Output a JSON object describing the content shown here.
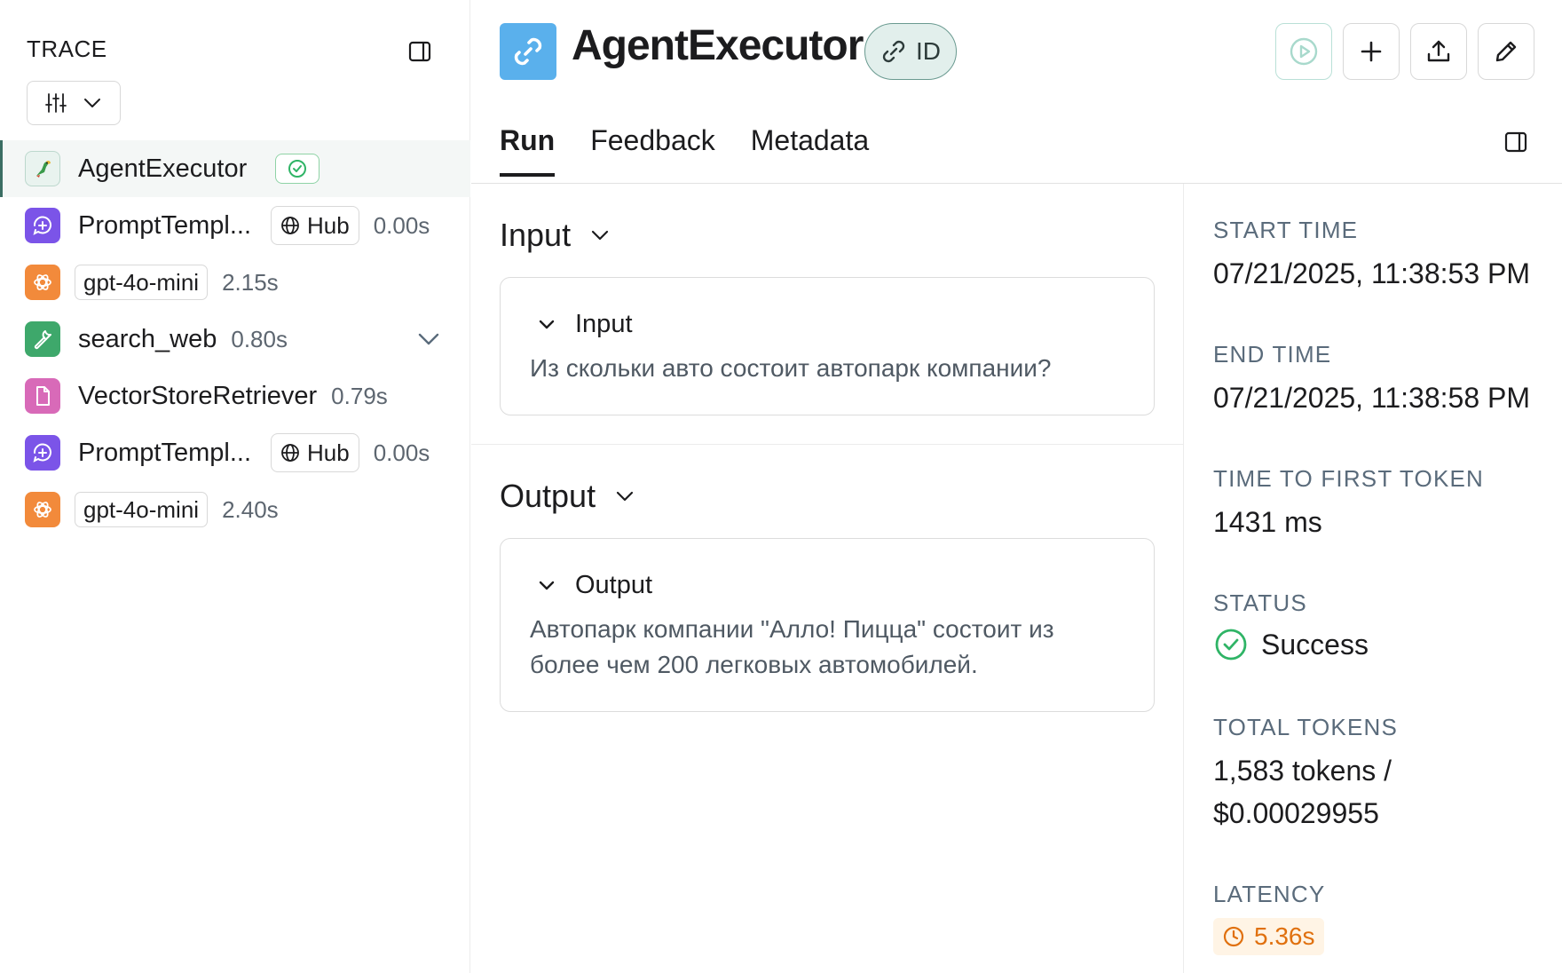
{
  "trace": {
    "header": "TRACE",
    "runs": [
      {
        "name": "AgentExecutor",
        "icon": "parrot-icon"
      },
      {
        "name": "PromptTempl...",
        "icon": "prompt-icon",
        "hub": "Hub",
        "duration": "0.00s"
      },
      {
        "model": "gpt-4o-mini",
        "icon": "openai-icon",
        "duration": "2.15s"
      },
      {
        "name": "search_web",
        "icon": "wrench-icon",
        "duration": "0.80s"
      },
      {
        "name": "VectorStoreRetriever",
        "icon": "document-icon",
        "duration": "0.79s"
      },
      {
        "name": "PromptTempl...",
        "icon": "prompt-icon",
        "hub": "Hub",
        "duration": "0.00s"
      },
      {
        "model": "gpt-4o-mini",
        "icon": "openai-icon",
        "duration": "2.40s"
      }
    ]
  },
  "header": {
    "title": "AgentExecutor",
    "id_label": "ID"
  },
  "tabs": [
    {
      "label": "Run",
      "active": true
    },
    {
      "label": "Feedback",
      "active": false
    },
    {
      "label": "Metadata",
      "active": false
    }
  ],
  "input": {
    "section_title": "Input",
    "card_title": "Input",
    "text": "Из скольки авто состоит автопарк компании?"
  },
  "output": {
    "section_title": "Output",
    "card_title": "Output",
    "text": "Автопарк компании \"Алло! Пицца\" состоит из более чем 200 легковых автомобилей."
  },
  "stats": {
    "start_time_label": "START TIME",
    "start_time": "07/21/2025, 11:38:53 PM",
    "end_time_label": "END TIME",
    "end_time": "07/21/2025, 11:38:58 PM",
    "ttft_label": "TIME TO FIRST TOKEN",
    "ttft": "1431 ms",
    "status_label": "STATUS",
    "status": "Success",
    "tokens_label": "TOTAL TOKENS",
    "tokens": "1,583 tokens /",
    "cost": "$0.00029955",
    "latency_label": "LATENCY",
    "latency": "5.36s"
  },
  "colors": {
    "accent": "#3b6e63",
    "success": "#2fb466",
    "latency": "#e0700e",
    "link_icon_bg": "#5ab0ec"
  }
}
